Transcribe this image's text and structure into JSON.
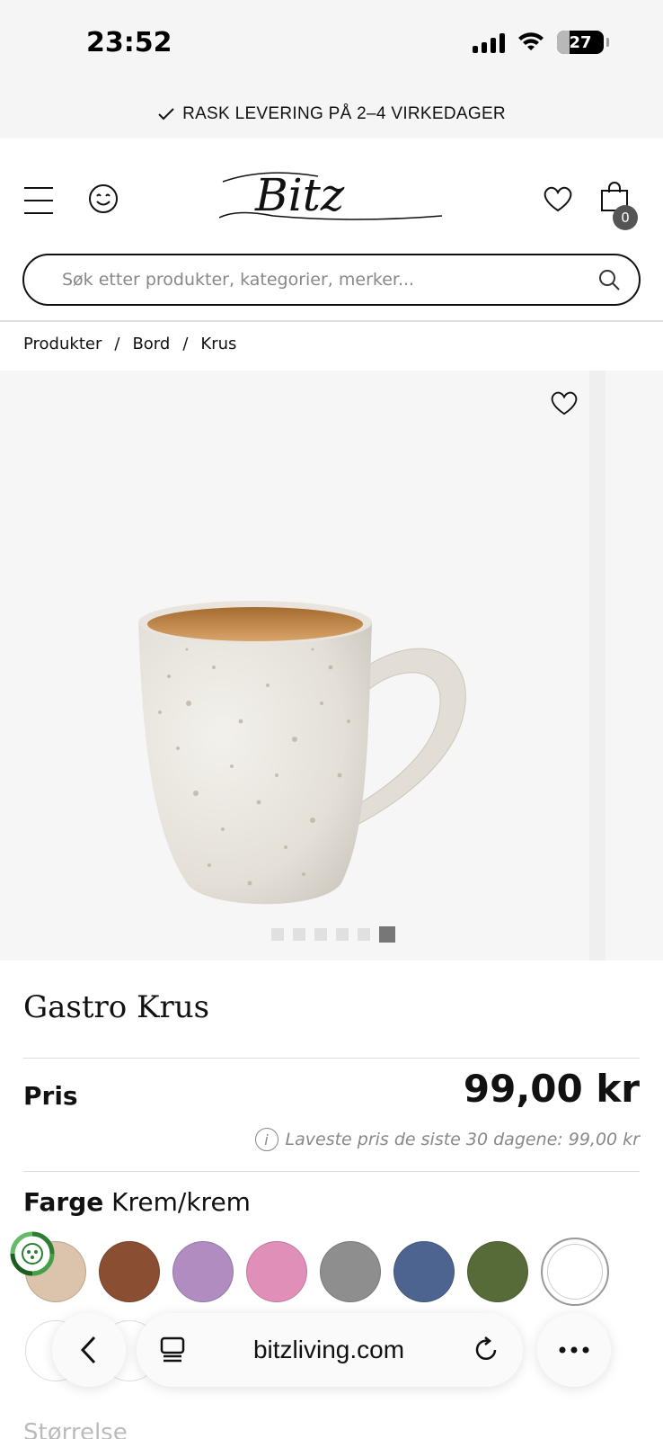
{
  "status_bar": {
    "time": "23:52",
    "battery": "27",
    "battery_level": 0.27
  },
  "promo": {
    "text": "RASK LEVERING PÅ 2–4 VIRKEDAGER"
  },
  "header": {
    "logo_text": "Bitz",
    "cart_count": "0"
  },
  "search": {
    "placeholder": "Søk etter produkter, kategorier, merker..."
  },
  "breadcrumb": {
    "items": [
      "Produkter",
      "Bord",
      "Krus"
    ],
    "separator": "/"
  },
  "gallery": {
    "image_count": 6,
    "active_index": 5
  },
  "product": {
    "title": "Gastro Krus",
    "price_label": "Pris",
    "price": "99,00 kr",
    "lowest_price_note": "Laveste pris de siste 30 dagene: 99,00 kr",
    "color_label": "Farge",
    "color_value": "Krem/krem",
    "swatches": [
      "#dcc3ab",
      "#8a4f33",
      "#b08cc0",
      "#e08fb9",
      "#8e8e8e",
      "#4d6490",
      "#566b38",
      "#ffffff"
    ],
    "size_label": "Størrelse"
  },
  "browser": {
    "url": "bitzliving.com"
  }
}
